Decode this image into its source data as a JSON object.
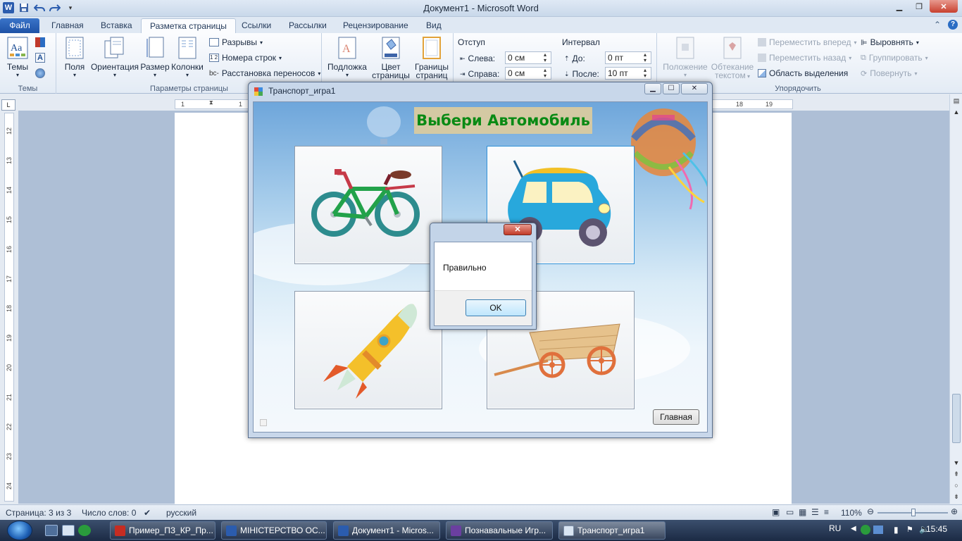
{
  "word": {
    "title": "Документ1 - Microsoft Word",
    "tabs": [
      "Файл",
      "Главная",
      "Вставка",
      "Разметка страницы",
      "Ссылки",
      "Рассылки",
      "Рецензирование",
      "Вид"
    ],
    "active_tab": "Разметка страницы"
  },
  "ribbon": {
    "themes": {
      "label": "Темы",
      "group": "Темы"
    },
    "page_setup": {
      "margins": "Поля",
      "orientation": "Ориентация",
      "size": "Размер",
      "columns": "Колонки",
      "breaks": "Разрывы",
      "line_numbers": "Номера строк",
      "hyphenation": "Расстановка переносов",
      "group": "Параметры страницы"
    },
    "background": {
      "watermark": "Подложка",
      "page_color_1": "Цвет",
      "page_color_2": "страницы",
      "borders_1": "Границы",
      "borders_2": "страниц"
    },
    "paragraph": {
      "indent_label": "Отступ",
      "left_label": "Слева:",
      "left_value": "0 см",
      "right_label": "Справа:",
      "right_value": "0 см",
      "spacing_label": "Интервал",
      "before_label": "До:",
      "before_value": "0 пт",
      "after_label": "После:",
      "after_value": "10 пт"
    },
    "arrange": {
      "position": "Положение",
      "wrap_1": "Обтекание",
      "wrap_2": "текстом",
      "bring_forward": "Переместить вперед",
      "send_backward": "Переместить назад",
      "selection_pane": "Область выделения",
      "align": "Выровнять",
      "group_btn": "Группировать",
      "rotate": "Повернуть",
      "group": "Упорядочить"
    }
  },
  "rulers": {
    "top_left": [
      "1",
      "1"
    ],
    "top_right": [
      "18",
      "19"
    ],
    "left": [
      "12",
      "13",
      "14",
      "15",
      "16",
      "17",
      "18",
      "19",
      "20",
      "21",
      "22",
      "23",
      "24"
    ]
  },
  "statusbar": {
    "page": "Страница: 3 из 3",
    "words": "Число слов: 0",
    "language": "русский",
    "zoom": "110%"
  },
  "taskbar": {
    "tasks": [
      "Пример_ПЗ_КР_Пр...",
      "МІНІСТЕРСТВО ОС...",
      "Документ1 - Micros...",
      "Познавальные Игр...",
      "Транспорт_игра1"
    ],
    "lang": "RU",
    "time": "15:45"
  },
  "app": {
    "title": "Транспорт_игра1",
    "headline": "Выбери Автомобиль",
    "home_button": "Главная"
  },
  "dialog": {
    "message": "Правильно",
    "ok": "OK"
  },
  "colors": {
    "headline_text": "#098a14",
    "headline_bg": "#d4c9a3",
    "selected_card_border": "#2f8fd6"
  }
}
